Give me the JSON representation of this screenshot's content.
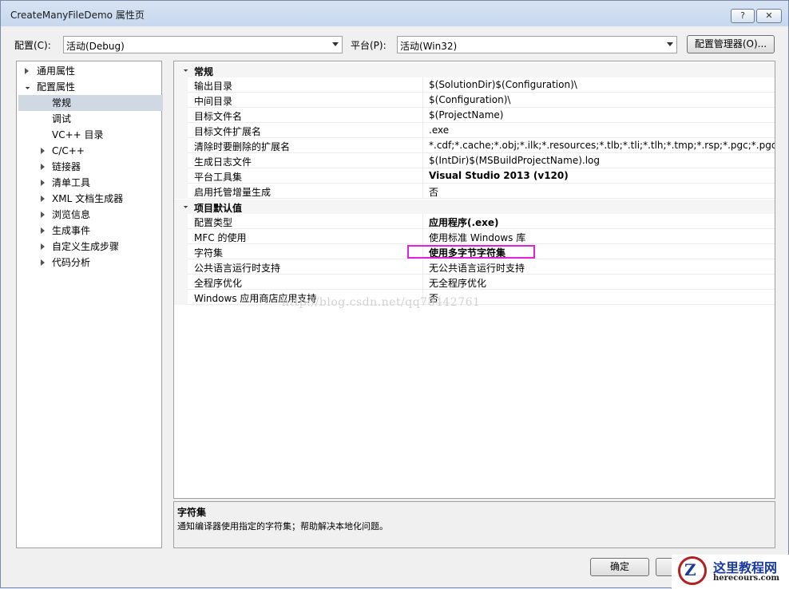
{
  "window": {
    "title": "CreateManyFileDemo 属性页",
    "help_button": "?",
    "close_button": "✕"
  },
  "toolbar": {
    "config_label": "配置(C):",
    "config_value": "活动(Debug)",
    "platform_label": "平台(P):",
    "platform_value": "活动(Win32)",
    "config_manager_button": "配置管理器(O)..."
  },
  "tree": {
    "items": [
      {
        "label": "通用属性",
        "expander": "collapsed"
      },
      {
        "label": "配置属性",
        "expander": "expanded"
      },
      {
        "label": "常规",
        "expander": "none",
        "selected": true
      },
      {
        "label": "调试",
        "expander": "none"
      },
      {
        "label": "VC++ 目录",
        "expander": "none"
      },
      {
        "label": "C/C++",
        "expander": "collapsed"
      },
      {
        "label": "链接器",
        "expander": "collapsed"
      },
      {
        "label": "清单工具",
        "expander": "collapsed"
      },
      {
        "label": "XML 文档生成器",
        "expander": "collapsed"
      },
      {
        "label": "浏览信息",
        "expander": "collapsed"
      },
      {
        "label": "生成事件",
        "expander": "collapsed"
      },
      {
        "label": "自定义生成步骤",
        "expander": "collapsed"
      },
      {
        "label": "代码分析",
        "expander": "collapsed"
      }
    ]
  },
  "grid": {
    "categories": [
      {
        "label": "常规",
        "rows": [
          {
            "name": "输出目录",
            "value": "$(SolutionDir)$(Configuration)\\",
            "bold": false
          },
          {
            "name": "中间目录",
            "value": "$(Configuration)\\",
            "bold": false
          },
          {
            "name": "目标文件名",
            "value": "$(ProjectName)",
            "bold": false
          },
          {
            "name": "目标文件扩展名",
            "value": ".exe",
            "bold": false
          },
          {
            "name": "清除时要删除的扩展名",
            "value": "*.cdf;*.cache;*.obj;*.ilk;*.resources;*.tlb;*.tli;*.tlh;*.tmp;*.rsp;*.pgc;*.pgd;*.meta",
            "bold": false
          },
          {
            "name": "生成日志文件",
            "value": "$(IntDir)$(MSBuildProjectName).log",
            "bold": false
          },
          {
            "name": "平台工具集",
            "value": "Visual Studio 2013 (v120)",
            "bold": true
          },
          {
            "name": "启用托管增量生成",
            "value": "否",
            "bold": false
          }
        ]
      },
      {
        "label": "项目默认值",
        "rows": [
          {
            "name": "配置类型",
            "value": "应用程序(.exe)",
            "bold": true
          },
          {
            "name": "MFC 的使用",
            "value": "使用标准 Windows 库",
            "bold": false
          },
          {
            "name": "字符集",
            "value": "使用多字节字符集",
            "bold": true
          },
          {
            "name": "公共语言运行时支持",
            "value": "无公共语言运行时支持",
            "bold": false
          },
          {
            "name": "全程序优化",
            "value": "无全程序优化",
            "bold": false
          },
          {
            "name": "Windows 应用商店应用支持",
            "value": "否",
            "bold": false
          }
        ]
      }
    ]
  },
  "watermark": "http://blog.csdn.net/qq78442761",
  "description": {
    "title": "字符集",
    "text": "通知编译器使用指定的字符集；帮助解决本地化问题。"
  },
  "footer": {
    "ok_button": "确定"
  },
  "logo": {
    "letter": "Z",
    "text": "这里教程网",
    "url": "herecours.com"
  },
  "colors": {
    "highlight_box": "#e023d9",
    "selected_tree_item": "#cfd8e3"
  }
}
